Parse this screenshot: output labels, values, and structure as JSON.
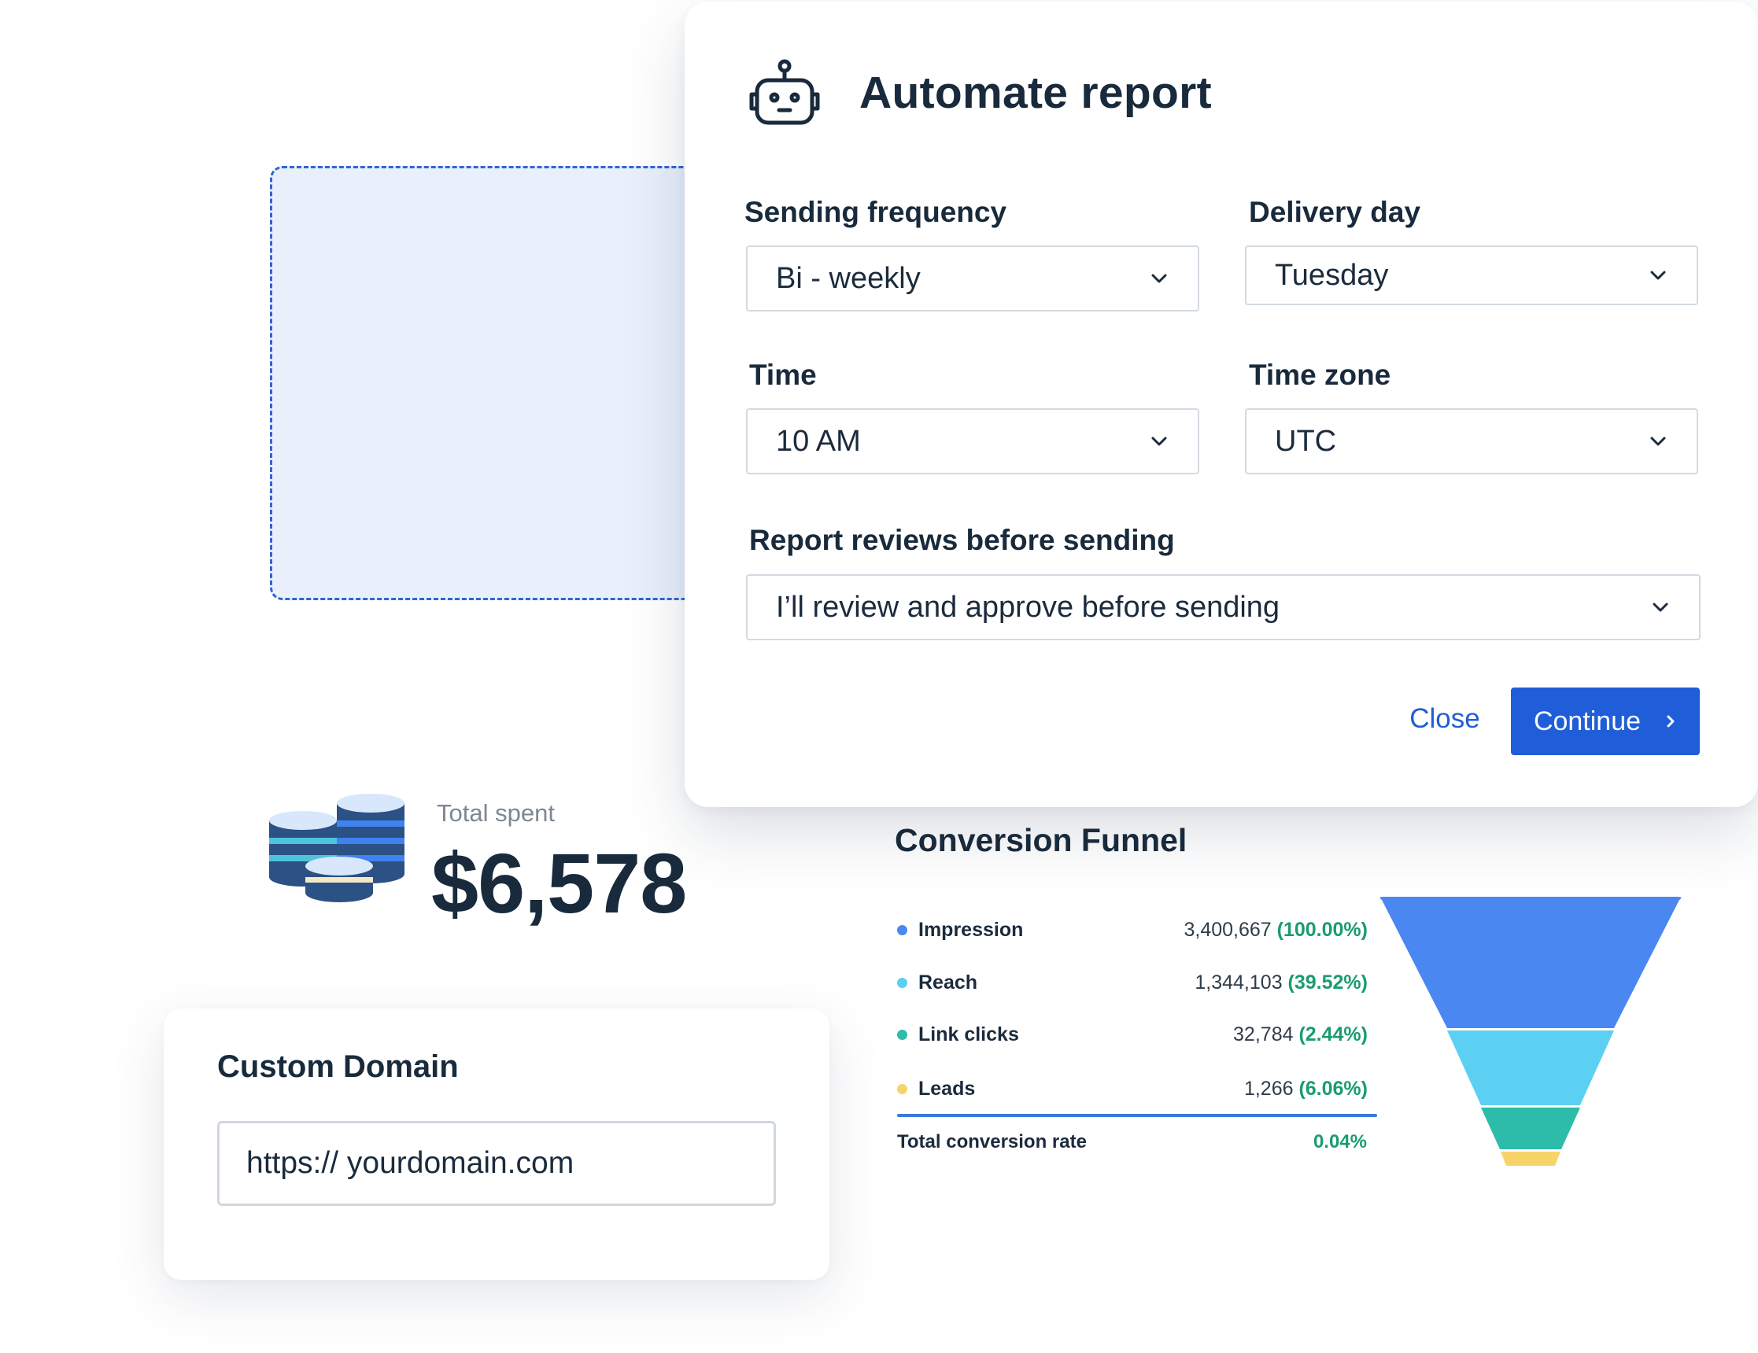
{
  "modal": {
    "title": "Automate report",
    "fields": {
      "frequency": {
        "label": "Sending frequency",
        "value": "Bi - weekly"
      },
      "delivery_day": {
        "label": "Delivery day",
        "value": "Tuesday"
      },
      "time": {
        "label": "Time",
        "value": "10 AM"
      },
      "time_zone": {
        "label": "Time zone",
        "value": "UTC"
      },
      "review": {
        "label": "Report reviews before sending",
        "value": "I’ll review and approve before sending"
      }
    },
    "close_label": "Close",
    "continue_label": "Continue",
    "icons": {
      "header": "robot-icon",
      "dropdown": "chevron-down-icon",
      "continue": "chevron-right-icon"
    }
  },
  "spent": {
    "label": "Total spent",
    "value": "$6,578",
    "icon": "coins-stack-icon"
  },
  "domain": {
    "title": "Custom Domain",
    "value": "https:// yourdomain.com"
  },
  "funnel": {
    "title": "Conversion Funnel",
    "rows": [
      {
        "label": "Impression",
        "count": "3,400,667",
        "pct": "(100.00%)",
        "color": "#4a87f0"
      },
      {
        "label": "Reach",
        "count": "1,344,103",
        "pct": "(39.52%)",
        "color": "#5bd0f3"
      },
      {
        "label": "Link clicks",
        "count": "32,784",
        "pct": "(2.44%)",
        "color": "#2dbcaa"
      },
      {
        "label": "Leads",
        "count": "1,266",
        "pct": "(6.06%)",
        "color": "#f7d46a"
      }
    ],
    "total_label": "Total conversion rate",
    "total_value": "0.04%"
  },
  "colors": {
    "primary": "#1f5ed8",
    "heading": "#182a3b",
    "success": "#1a9c6e",
    "placeholder_bg": "#e9effb"
  }
}
